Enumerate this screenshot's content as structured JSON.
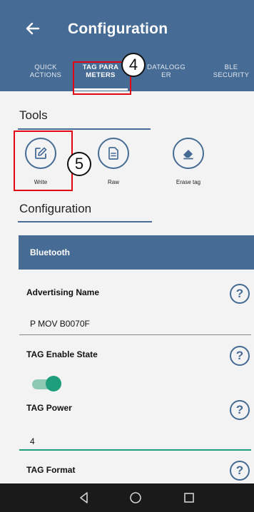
{
  "appbar": {
    "title": "Configuration"
  },
  "tabs": [
    {
      "line1": "QUICK",
      "line2": "ACTIONS"
    },
    {
      "line1": "TAG PARA",
      "line2": "METERS"
    },
    {
      "line1": "DATALOGG",
      "line2": "ER"
    },
    {
      "line1": "BLE",
      "line2": "SECURITY"
    }
  ],
  "callouts": {
    "tab_step": "4",
    "write_step": "5"
  },
  "tools": {
    "title": "Tools",
    "write_label": "Write",
    "raw_label": "Raw",
    "erase_label": "Erase tag"
  },
  "configuration": {
    "title": "Configuration"
  },
  "bluetooth": {
    "header": "Bluetooth",
    "advertising_name_label": "Advertising Name",
    "advertising_name_value": "P MOV B0070F",
    "tag_enable_label": "TAG Enable State",
    "tag_enable_on": true,
    "tag_power_label": "TAG Power",
    "tag_power_value": "4",
    "tag_format_label": "TAG Format",
    "help_glyph": "?"
  },
  "colors": {
    "primary": "#466b94",
    "accent": "#1f9e7c",
    "highlight": "#e30613"
  }
}
